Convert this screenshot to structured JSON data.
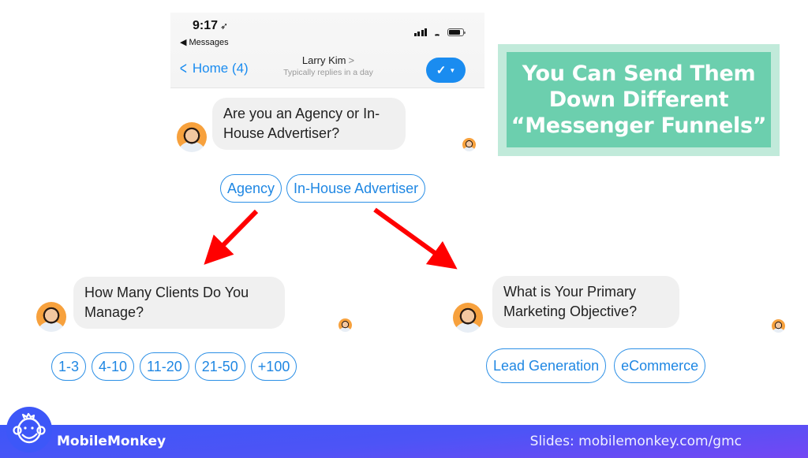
{
  "phone": {
    "status_time": "9:17",
    "location_icon": "location-arrow-icon",
    "back_app_label": "◀ Messages",
    "battery_level": 0.8,
    "nav_back_label": "Home (4)",
    "contact_name": "Larry Kim",
    "contact_subtitle": "Typically replies in a day",
    "action_icon": "checkmark-icon"
  },
  "conversation_1": {
    "question": "Are you an Agency or In-House Advertiser?",
    "replies": [
      "Agency",
      "In-House Advertiser"
    ]
  },
  "conversation_2": {
    "question": "How Many Clients Do You Manage?",
    "replies": [
      "1-3",
      "4-10",
      "11-20",
      "21-50",
      "+100"
    ]
  },
  "conversation_3": {
    "question": "What is Your Primary Marketing Objective?",
    "replies": [
      "Lead Generation",
      "eCommerce"
    ]
  },
  "callout": {
    "text": "You Can Send Them\nDown Different\n“Messenger Funnels”"
  },
  "footer": {
    "brand": "MobileMonkey",
    "slides_link": "Slides: mobilemonkey.com/gmc"
  },
  "colors": {
    "messenger_blue": "#1a8cf0",
    "callout_green": "#6ccfae",
    "callout_border": "#c1eada",
    "arrow_red": "#ff0000",
    "footer_start": "#3d57f8",
    "footer_end": "#7447f3"
  }
}
